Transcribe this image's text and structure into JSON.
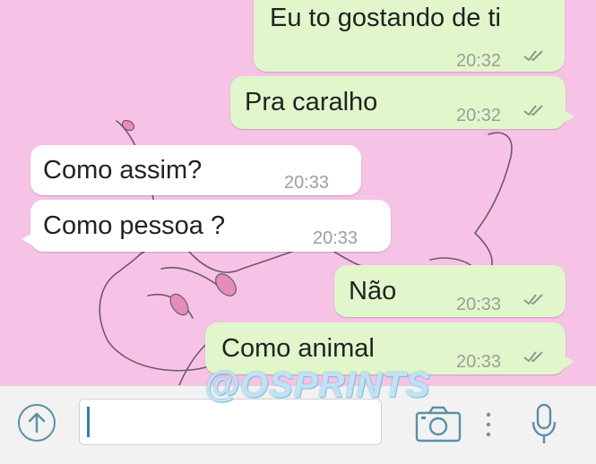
{
  "messages": [
    {
      "direction": "out",
      "text": "Eu to gostando de ti",
      "time": "20:32",
      "status": "read"
    },
    {
      "direction": "out",
      "text": "Pra caralho",
      "time": "20:32",
      "status": "read"
    },
    {
      "direction": "in",
      "text": "Como assim?",
      "time": "20:33"
    },
    {
      "direction": "in",
      "text": "Como pessoa ?",
      "time": "20:33"
    },
    {
      "direction": "out",
      "text": "Não",
      "time": "20:33",
      "status": "read"
    },
    {
      "direction": "out",
      "text": "Como animal",
      "time": "20:33",
      "status": "read"
    }
  ],
  "watermark": "@OSPRINTS",
  "input_bar": {
    "upload_icon": "arrow-up-circle-icon",
    "camera_icon": "camera-icon",
    "more_icon": "vertical-dots-icon",
    "mic_icon": "microphone-icon",
    "text_value": ""
  },
  "colors": {
    "background": "#f6c3e6",
    "outgoing_bubble": "#e1f6cb",
    "incoming_bubble": "#ffffff",
    "timestamp": "#9aa09a",
    "read_ticks": "#8a9a8a",
    "icon_blue": "#5b8fa8"
  }
}
